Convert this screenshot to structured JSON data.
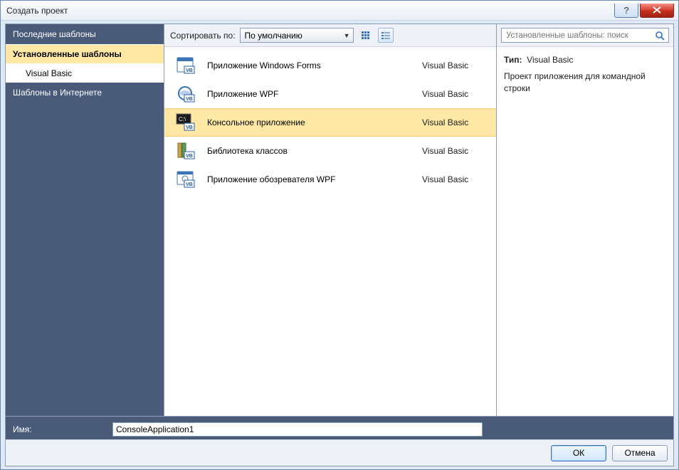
{
  "window": {
    "title": "Создать проект"
  },
  "sidebar": {
    "recent": "Последние шаблоны",
    "installed": "Установленные шаблоны",
    "subitem": "Visual Basic",
    "online": "Шаблоны в Интернете"
  },
  "toolbar": {
    "sort_label": "Сортировать по:",
    "sort_value": "По умолчанию"
  },
  "search": {
    "placeholder": "Установленные шаблоны: поиск"
  },
  "templates": [
    {
      "name": "Приложение Windows Forms",
      "lang": "Visual Basic",
      "icon": "forms",
      "selected": false
    },
    {
      "name": "Приложение WPF",
      "lang": "Visual Basic",
      "icon": "wpf",
      "selected": false
    },
    {
      "name": "Консольное приложение",
      "lang": "Visual Basic",
      "icon": "console",
      "selected": true
    },
    {
      "name": "Библиотека классов",
      "lang": "Visual Basic",
      "icon": "lib",
      "selected": false
    },
    {
      "name": "Приложение обозревателя WPF",
      "lang": "Visual Basic",
      "icon": "wpfb",
      "selected": false
    }
  ],
  "info": {
    "type_label": "Тип:",
    "type_value": "Visual Basic",
    "description": "Проект приложения для командной строки"
  },
  "form": {
    "name_label": "Имя:",
    "name_value": "ConsoleApplication1"
  },
  "buttons": {
    "ok": "ОК",
    "cancel": "Отмена"
  }
}
